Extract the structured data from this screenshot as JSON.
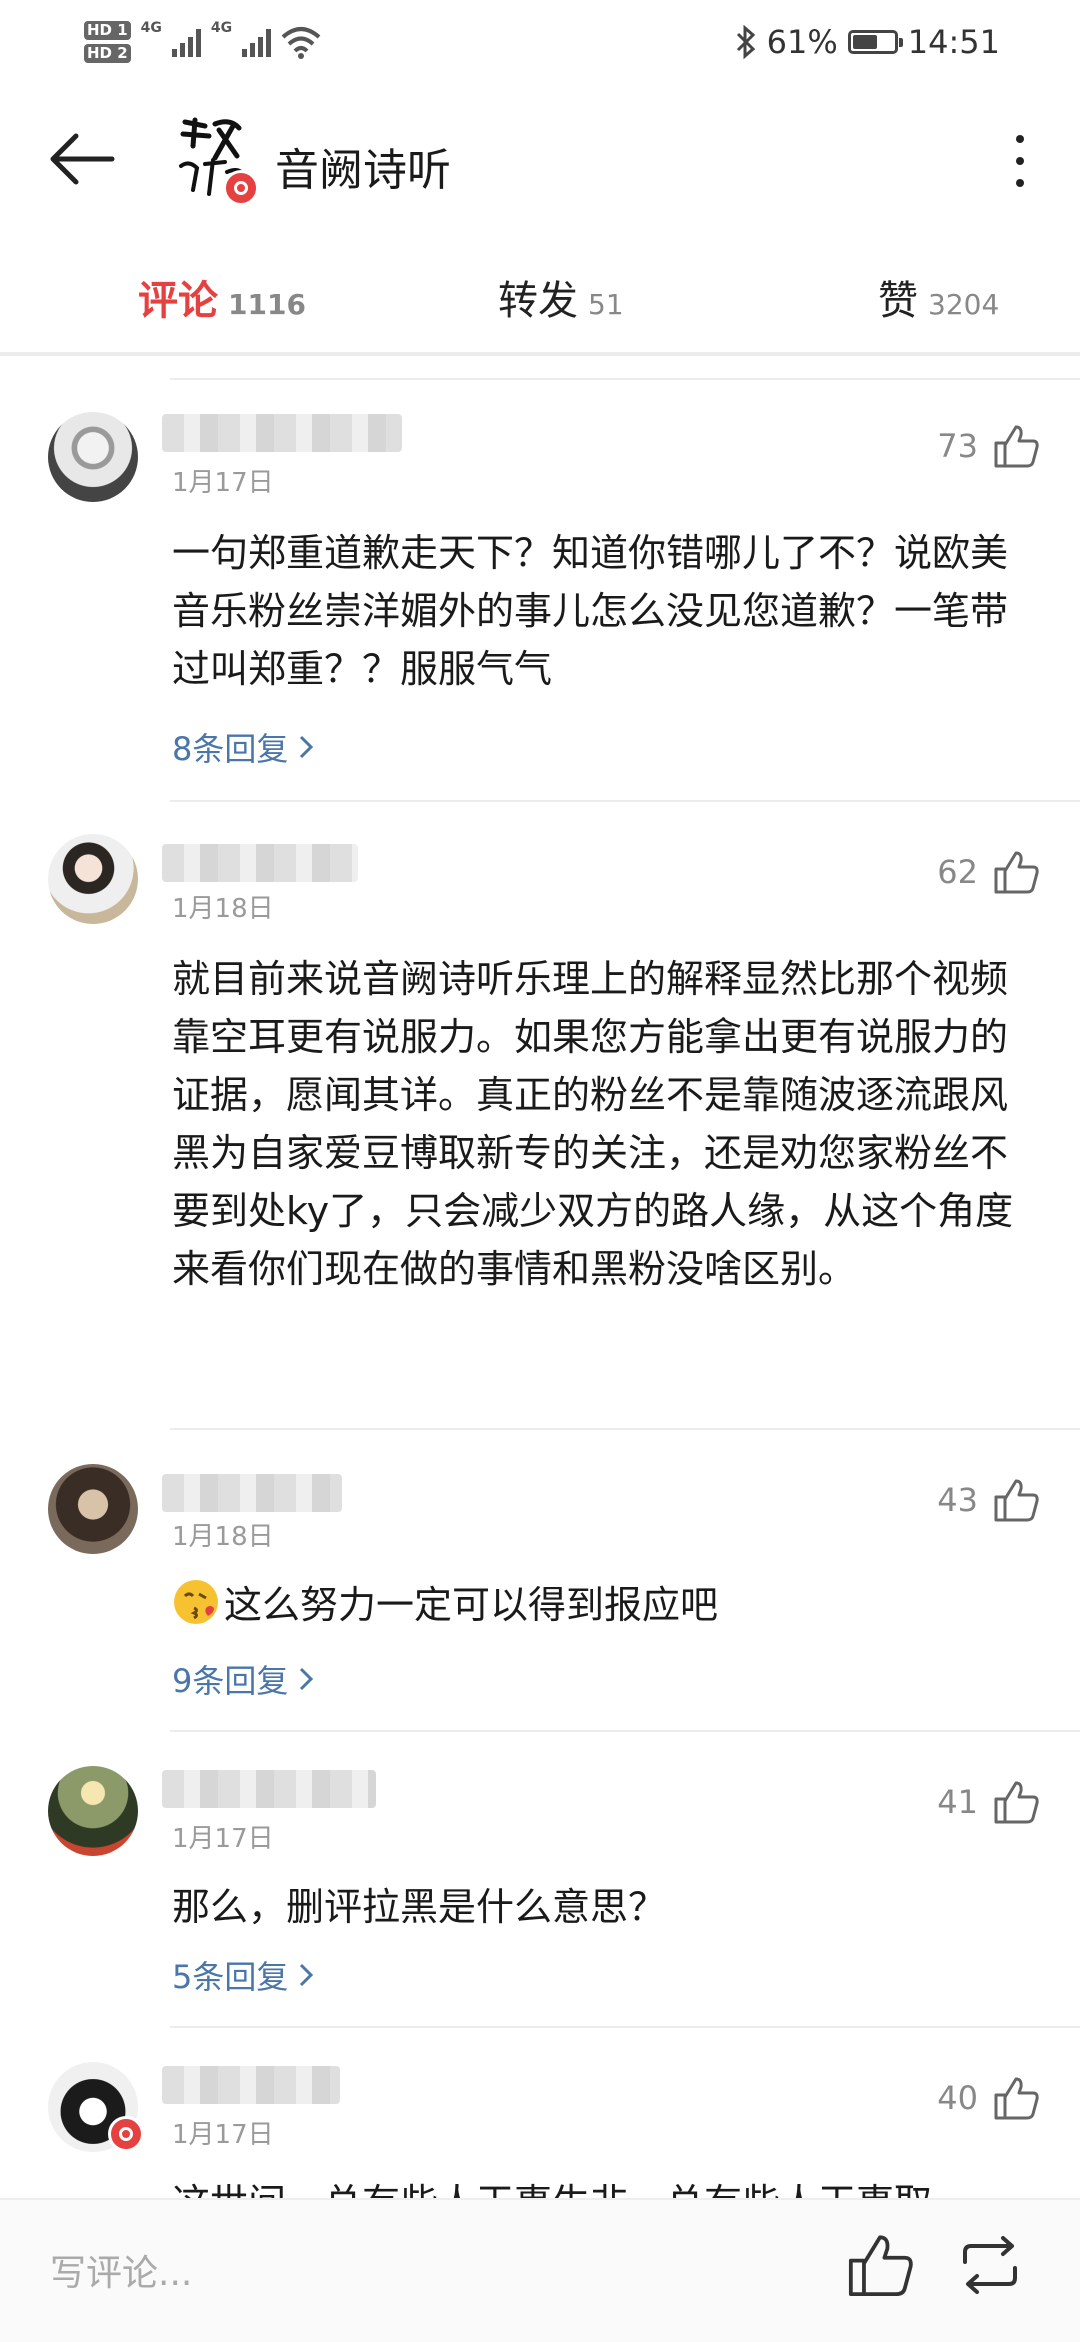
{
  "status_bar": {
    "hd1": "HD 1",
    "hd2": "HD 2",
    "network1": "4G",
    "network2": "4G",
    "battery_percent": "61%",
    "battery_level": 0.61,
    "time": "14:51",
    "icons": [
      "bluetooth-icon",
      "wifi-icon",
      "signal-icon",
      "battery-icon"
    ]
  },
  "header": {
    "title": "音阙诗听",
    "logo_text": "音阙诗听",
    "back_icon": "arrow-left-icon",
    "more_icon": "more-vertical-icon"
  },
  "tabs": [
    {
      "label": "评论",
      "count": "1116",
      "active": true
    },
    {
      "label": "转发",
      "count": "51",
      "active": false
    },
    {
      "label": "赞",
      "count": "3204",
      "active": false
    }
  ],
  "comments": [
    {
      "date": "1月17日",
      "likes": "73",
      "text": "一句郑重道歉走天下？知道你错哪儿了不？说欧美音乐粉丝崇洋媚外的事儿怎么没见您道歉？一笔带过叫郑重？？服服气气",
      "replies": "8条回复"
    },
    {
      "date": "1月18日",
      "likes": "62",
      "text": "就目前来说音阙诗听乐理上的解释显然比那个视频靠空耳更有说服力。如果您方能拿出更有说服力的证据，愿闻其详。真正的粉丝不是靠随波逐流跟风黑为自家爱豆博取新专的关注，还是劝您家粉丝不要到处ky了，只会减少双方的路人缘，从这个角度来看你们现在做的事情和黑粉没啥区别。",
      "replies": ""
    },
    {
      "date": "1月18日",
      "likes": "43",
      "text": "这么努力一定可以得到报应吧",
      "emoji": "kissing-face-emoji",
      "replies": "9条回复"
    },
    {
      "date": "1月17日",
      "likes": "41",
      "text": "那么，删评拉黑是什么意思？",
      "replies": "5条回复"
    },
    {
      "date": "1月17日",
      "likes": "40",
      "text": "这世间，总有些人干事生非，总有些人干事取",
      "replies": ""
    }
  ],
  "bottom_bar": {
    "placeholder": "写评论...",
    "like_icon": "thumbs-up-icon",
    "repost_icon": "repost-icon"
  },
  "colors": {
    "accent": "#e64141",
    "link": "#4a76a8",
    "muted": "#888888"
  }
}
